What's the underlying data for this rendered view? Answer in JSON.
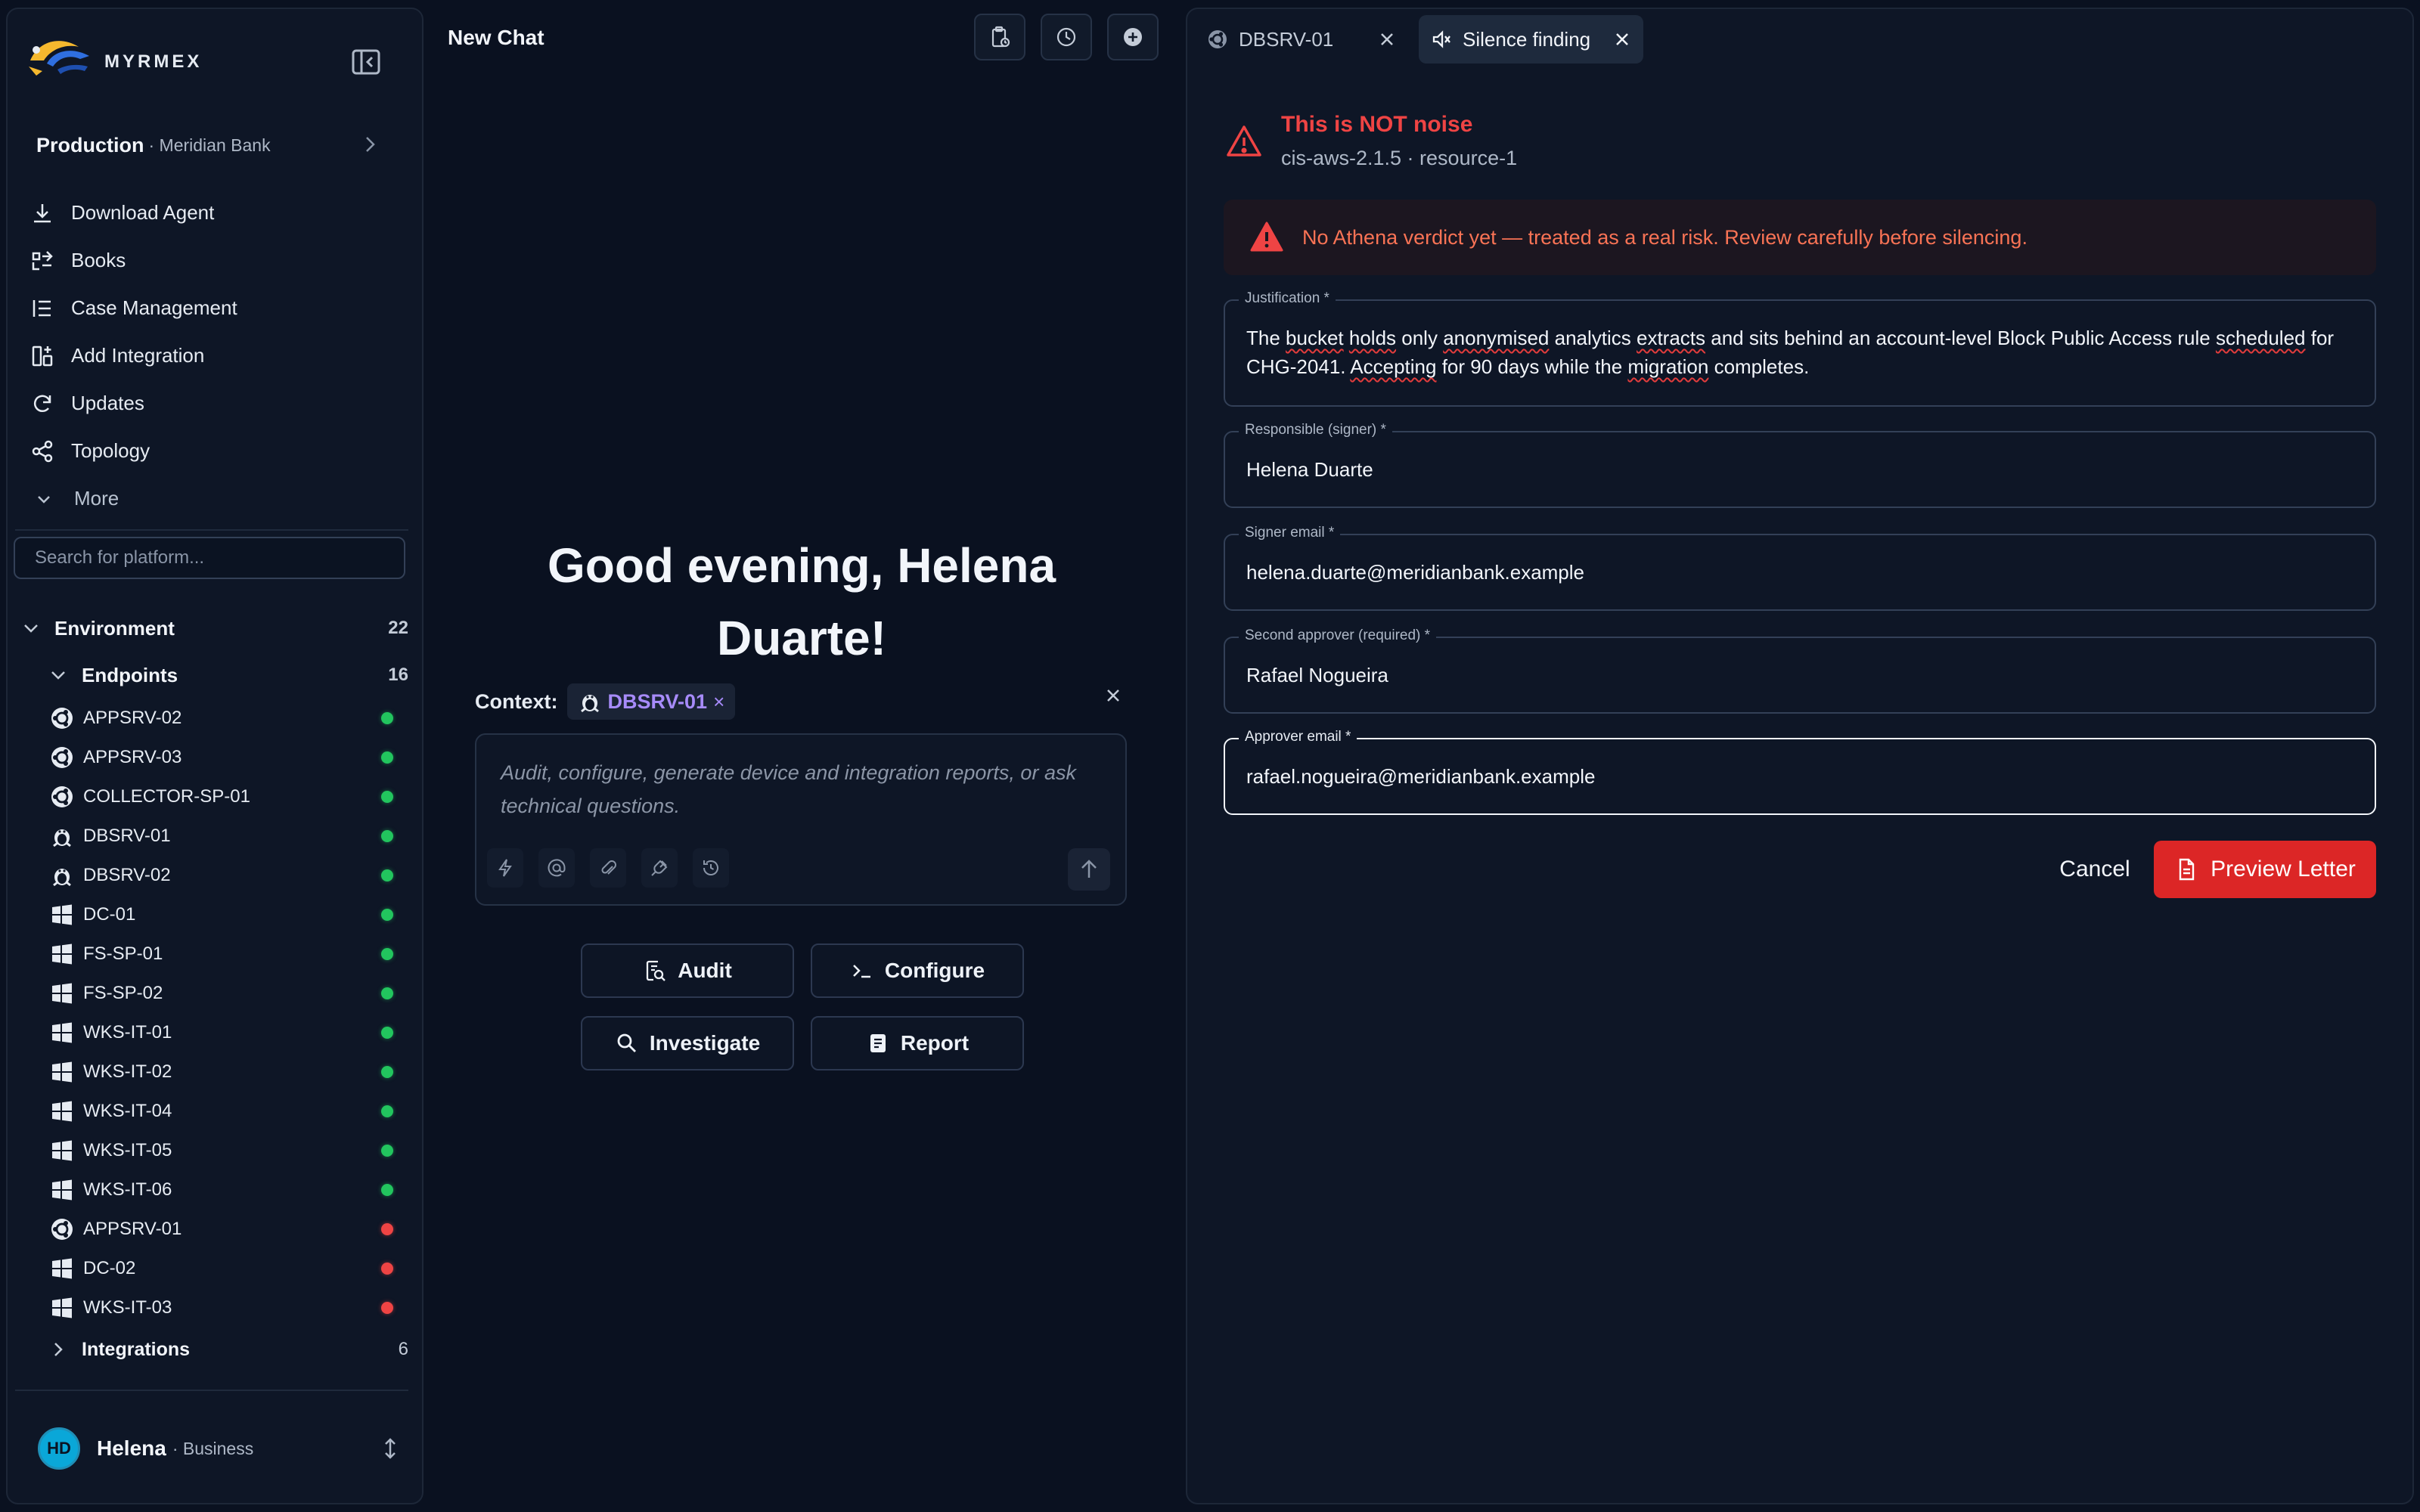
{
  "app": {
    "logo_text": "MYRMEX"
  },
  "org": {
    "name": "Production",
    "sub": "· Meridian Bank"
  },
  "nav": [
    {
      "label": "Download Agent",
      "icon": "download-icon"
    },
    {
      "label": "Books",
      "icon": "books-icon"
    },
    {
      "label": "Case Management",
      "icon": "list-icon"
    },
    {
      "label": "Add Integration",
      "icon": "grid-plus-icon"
    },
    {
      "label": "Updates",
      "icon": "refresh-icon"
    },
    {
      "label": "Topology",
      "icon": "share-icon"
    },
    {
      "label": "More",
      "icon": "chevron-down-icon"
    }
  ],
  "search": {
    "placeholder": "Search for platform..."
  },
  "tree": {
    "environment": {
      "label": "Environment",
      "count": "22"
    },
    "endpoints": {
      "label": "Endpoints",
      "count": "16"
    },
    "items": [
      {
        "name": "APPSRV-02",
        "os": "ubuntu",
        "status": "online"
      },
      {
        "name": "APPSRV-03",
        "os": "ubuntu",
        "status": "online"
      },
      {
        "name": "COLLECTOR-SP-01",
        "os": "ubuntu",
        "status": "online"
      },
      {
        "name": "DBSRV-01",
        "os": "linux",
        "status": "online"
      },
      {
        "name": "DBSRV-02",
        "os": "linux",
        "status": "online"
      },
      {
        "name": "DC-01",
        "os": "windows",
        "status": "online"
      },
      {
        "name": "FS-SP-01",
        "os": "windows",
        "status": "online"
      },
      {
        "name": "FS-SP-02",
        "os": "windows",
        "status": "online"
      },
      {
        "name": "WKS-IT-01",
        "os": "windows",
        "status": "online"
      },
      {
        "name": "WKS-IT-02",
        "os": "windows",
        "status": "online"
      },
      {
        "name": "WKS-IT-04",
        "os": "windows",
        "status": "online"
      },
      {
        "name": "WKS-IT-05",
        "os": "windows",
        "status": "online"
      },
      {
        "name": "WKS-IT-06",
        "os": "windows",
        "status": "online"
      },
      {
        "name": "APPSRV-01",
        "os": "ubuntu",
        "status": "offline"
      },
      {
        "name": "DC-02",
        "os": "windows",
        "status": "offline"
      },
      {
        "name": "WKS-IT-03",
        "os": "windows",
        "status": "offline"
      }
    ],
    "integrations": {
      "label": "Integrations",
      "count": "6"
    }
  },
  "user": {
    "initials": "HD",
    "name": "Helena",
    "plan": "· Business"
  },
  "chat": {
    "title": "New Chat",
    "greeting": "Good evening, Helena Duarte!",
    "context_label": "Context:",
    "context_chip": "DBSRV-01",
    "context_chip_remove": "×",
    "placeholder": "Audit, configure, generate device and integration reports, or ask technical questions.",
    "quick_actions": [
      {
        "label": "Audit",
        "icon": "audit-icon"
      },
      {
        "label": "Configure",
        "icon": "terminal-icon"
      },
      {
        "label": "Investigate",
        "icon": "search-icon"
      },
      {
        "label": "Report",
        "icon": "report-icon"
      }
    ]
  },
  "tabs": [
    {
      "label": "DBSRV-01",
      "active": false
    },
    {
      "label": "Silence finding",
      "active": true
    }
  ],
  "finding": {
    "title": "This is NOT noise",
    "subtitle": "cis-aws-2.1.5 · resource-1",
    "alert": "No Athena verdict yet — treated as a real risk. Review carefully before silencing."
  },
  "form": {
    "justification": {
      "label": "Justification *",
      "line1_pre": "The ",
      "line1_w1": "bucket",
      "line1_mid1": " ",
      "line1_w2": "holds",
      "line1_mid2": " only ",
      "line1_w3": "anonymised",
      "line1_mid3": " analytics ",
      "line1_w4": "extracts",
      "line1_mid4": " and sits behind an account-level Block Public Access rule ",
      "line1_w5": "scheduled",
      "line1_post": " for",
      "line2_pre": "CHG-2041. ",
      "line2_w1": "Accepting",
      "line2_mid1": " for 90 days while the ",
      "line2_w2": "migration",
      "line2_post": " completes."
    },
    "signer": {
      "label": "Responsible (signer) *",
      "value": "Helena Duarte"
    },
    "signer_email": {
      "label": "Signer email *",
      "value": "helena.duarte@meridianbank.example"
    },
    "approver": {
      "label": "Second approver (required) *",
      "value": "Rafael Nogueira"
    },
    "approver_email": {
      "label": "Approver email *",
      "value": "rafael.nogueira@meridianbank.example"
    },
    "cancel": "Cancel",
    "submit": "Preview Letter"
  },
  "colors": {
    "accent_danger": "#dc2626",
    "online": "#22c55e",
    "offline": "#ef4444",
    "context": "#a78bfa"
  }
}
